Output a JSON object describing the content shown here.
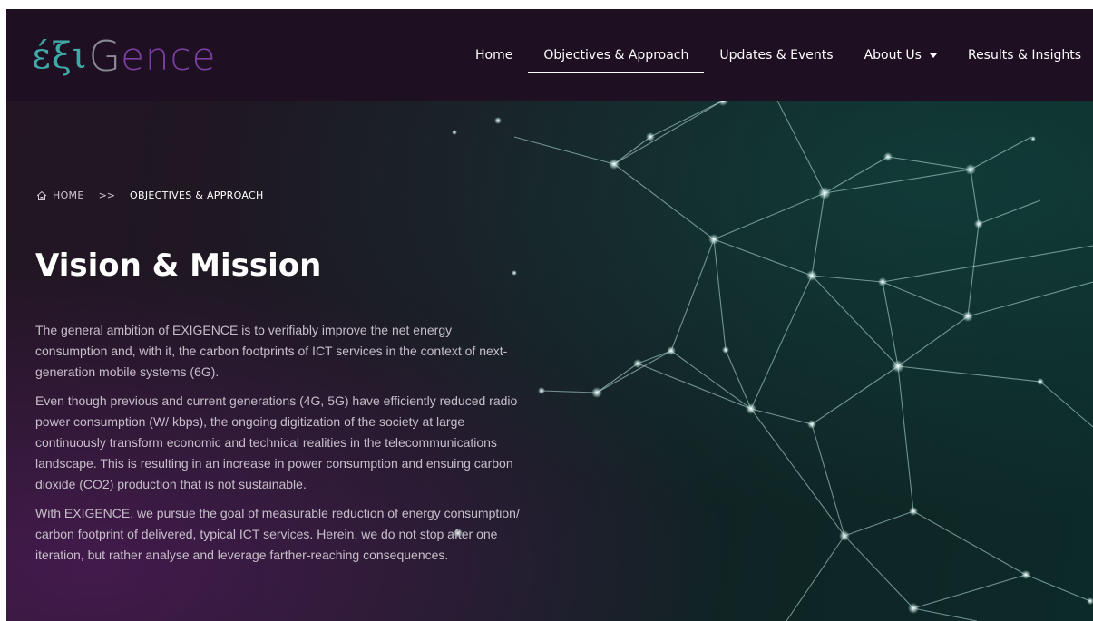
{
  "logo": {
    "greek": "έξι",
    "g": "G",
    "ence": "ence"
  },
  "nav": {
    "items": [
      {
        "label": "Home"
      },
      {
        "label": "Objectives & Approach"
      },
      {
        "label": "Updates & Events"
      },
      {
        "label": "About Us"
      },
      {
        "label": "Results & Insights"
      }
    ]
  },
  "breadcrumb": {
    "home": "HOME",
    "separator": ">>",
    "current": "OBJECTIVES & APPROACH"
  },
  "main": {
    "title": "Vision & Mission",
    "paragraphs": [
      "The general ambition of EXIGENCE is to verifiably improve the net energy consumption and, with it, the carbon footprints of ICT services in the context of next-generation mobile systems (6G).",
      "Even though previous and current generations (4G, 5G) have efficiently reduced radio power consumption (W/ kbps), the ongoing digitization of the society at large continuously transform economic and technical realities in the telecommunications landscape. This is resulting in an increase in power consumption and ensuing carbon dioxide (CO2) production that is not sustainable.",
      "With EXIGENCE, we pursue the goal of measurable reduction of energy consumption/ carbon footprint of delivered, typical ICT services. Herein, we do not stop after one iteration, but rather analyse and leverage farther-reaching consequences."
    ]
  },
  "colors": {
    "nav_bg": "#1f0f22",
    "logo_teal": "#3fa9a8",
    "logo_purple": "#7b3fa0",
    "text": "#c6bec9",
    "network_line": "#bfe9e4"
  },
  "icons": {
    "home": "home-icon",
    "dropdown": "caret-down-icon"
  }
}
